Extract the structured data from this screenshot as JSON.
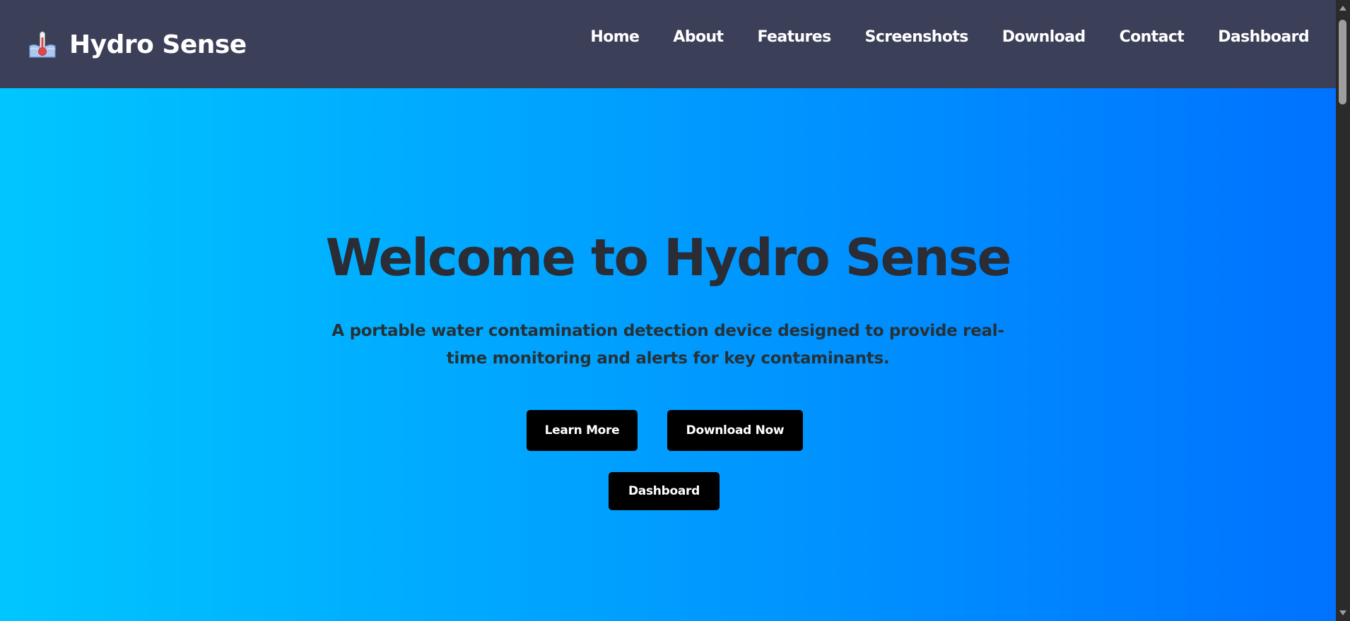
{
  "header": {
    "brand_title": "Hydro Sense",
    "brand_icon": "water-level-thermometer-icon",
    "background_color": "#3b3f58",
    "nav": [
      {
        "label": "Home"
      },
      {
        "label": "About"
      },
      {
        "label": "Features"
      },
      {
        "label": "Screenshots"
      },
      {
        "label": "Download"
      },
      {
        "label": "Contact"
      },
      {
        "label": "Dashboard"
      }
    ]
  },
  "hero": {
    "title": "Welcome to Hydro Sense",
    "subtitle": "A portable water contamination detection device designed to provide real-time monitoring and alerts for key contaminants.",
    "gradient_start": "#00c6ff",
    "gradient_end": "#0072ff",
    "buttons": {
      "learn_more": "Learn More",
      "download_now": "Download Now",
      "dashboard": "Dashboard"
    }
  }
}
